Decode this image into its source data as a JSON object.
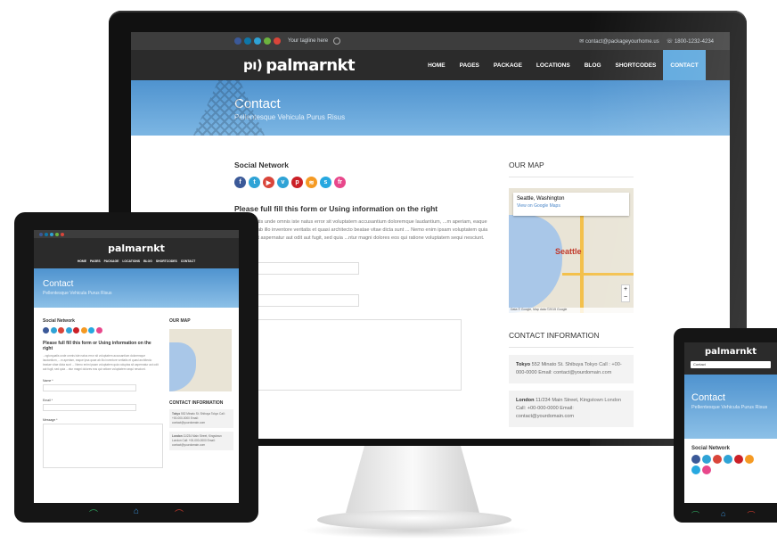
{
  "colors": {
    "accent": "#5aa6dd",
    "dark_nav": "#2b2b2b",
    "hero_top": "#4f93cf",
    "hero_bottom": "#7cb6e3"
  },
  "site": {
    "logo": "palmarnkt",
    "logo_mark": "pı)",
    "tagline": "Your tagline here",
    "email": "contact@packageyourhome.us",
    "phone": "1800-1232-4234",
    "menu": [
      "HOME",
      "PAGES",
      "PACKAGE",
      "LOCATIONS",
      "BLOG",
      "SHORTCODES",
      "CONTACT"
    ],
    "hero_title": "Contact",
    "hero_subtitle": "Pellentesque Vehicula Purus Risus",
    "social_title": "Social Network",
    "social_icons": [
      {
        "name": "facebook-icon",
        "glyph": "f",
        "color": "#3b5998"
      },
      {
        "name": "twitter-icon",
        "glyph": "t",
        "color": "#2fa3d6"
      },
      {
        "name": "youtube-icon",
        "glyph": "▶",
        "color": "#d9453a"
      },
      {
        "name": "vimeo-icon",
        "glyph": "v",
        "color": "#2fa3d6"
      },
      {
        "name": "pinterest-icon",
        "glyph": "p",
        "color": "#cb2027"
      },
      {
        "name": "rss-icon",
        "glyph": "≋",
        "color": "#f59a23"
      },
      {
        "name": "skype-icon",
        "glyph": "s",
        "color": "#27a8e0"
      },
      {
        "name": "flickr-icon",
        "glyph": "fr",
        "color": "#e8478b"
      }
    ],
    "form_title": "Please full fill this form or Using information on the right",
    "form_paragraph": "...ngtorquatis unde omnis iste natus error sit voluptatem accusantium doloremque laudantium, ...m aperiam, eaque ipsa quae ab illo inventore veritatis et quasi architecto beatae vitae dicta sunt ... Nemo enim ipsam voluptatem quia voluptas sit aspernatur aut odit aut fugit, sed quia ...ntur magni dolores eos qui ratione voluptatem sequi nesciunt.",
    "name_label": "Name *",
    "email_label": "Email *",
    "message_label": "Message *",
    "map_title": "OUR MAP",
    "map_place": "Seattle, Washington",
    "map_link": "View on Google Maps",
    "map_city": "Seattle",
    "map_footer": "Data © Google, Map data ©2015 Google",
    "contact_title": "CONTACT INFORMATION",
    "contacts": [
      {
        "city": "Tokyo",
        "text": "552 Minato St. Shibuya Tokyo Call : +00-000-0000 Email: contact@yourdomain.com"
      },
      {
        "city": "London",
        "text": "11/234 Main Street, Kingstown London Call: +00-000-0000 Email: contact@yourdomain.com"
      }
    ],
    "phone_select": "Contact"
  }
}
